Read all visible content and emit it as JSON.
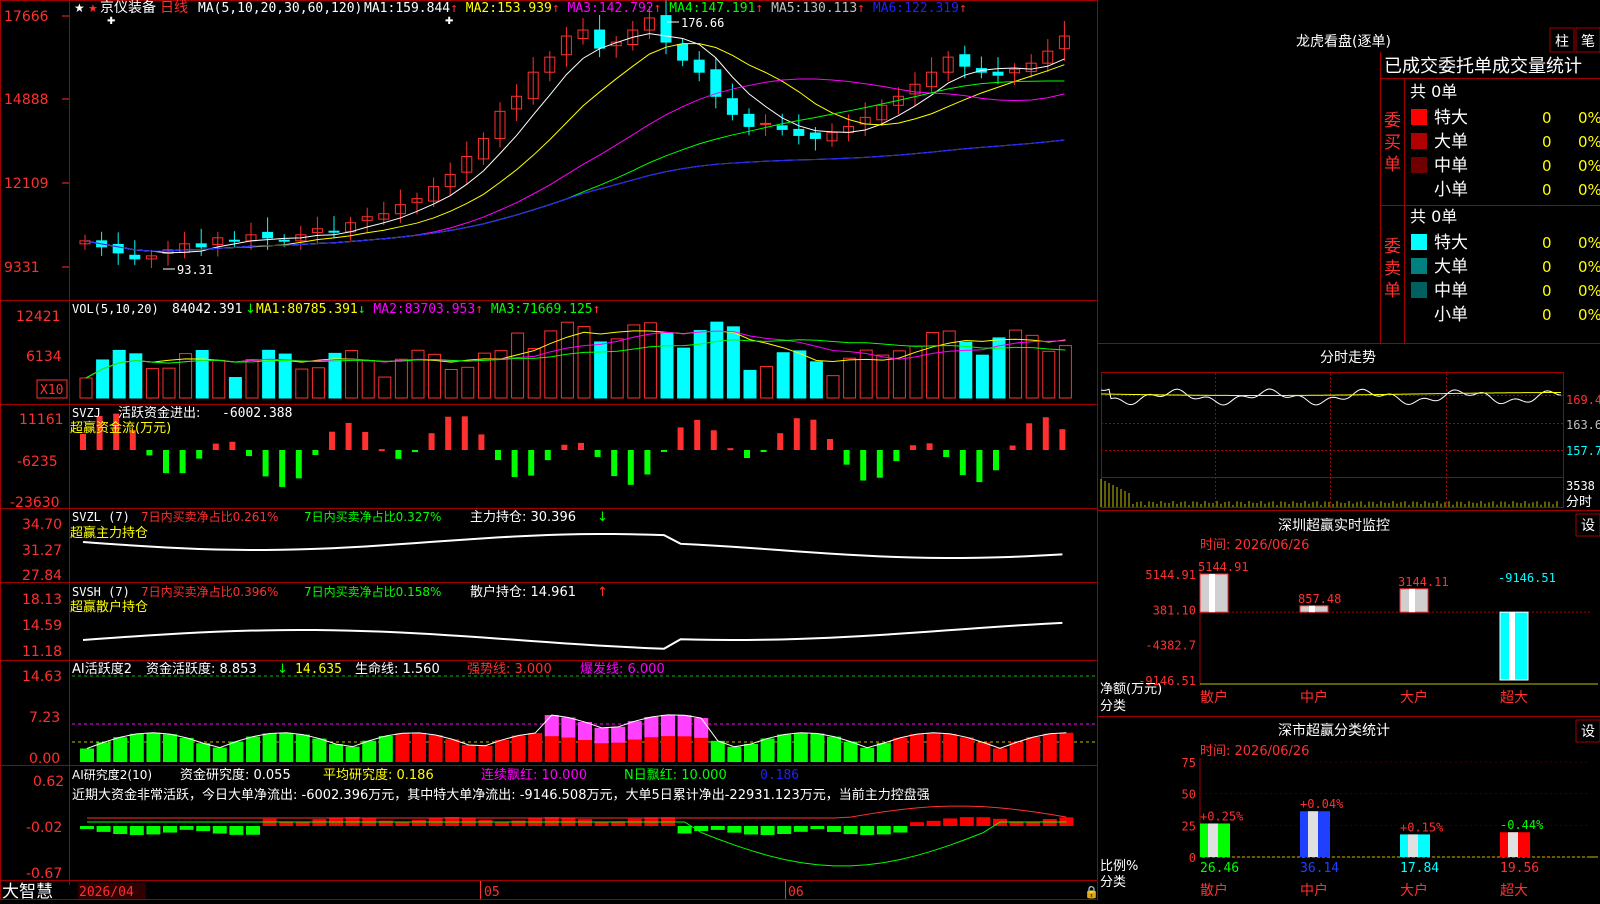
{
  "stock": {
    "name": "京仪装备",
    "period": "日线",
    "footer_brand": "大智慧"
  },
  "main_panel": {
    "ma_title": "MA(5,10,20,30,60,120)",
    "indicators": [
      {
        "label": "MA1:",
        "value": "159.844",
        "arrow": "↑",
        "color": "#ffffff"
      },
      {
        "label": "MA2:",
        "value": "153.939",
        "arrow": "↑",
        "color": "#ffff00"
      },
      {
        "label": "MA3:",
        "value": "142.792",
        "arrow": "↑",
        "color": "#ff00ff"
      },
      {
        "label": "MA4:",
        "value": "147.191",
        "arrow": "↑",
        "color": "#00ff00"
      },
      {
        "label": "MA5:",
        "value": "130.113",
        "arrow": "↑",
        "color": "#c0c0c0"
      },
      {
        "label": "MA6:",
        "value": "122.319",
        "arrow": "↑",
        "color": "#2020ff"
      }
    ],
    "y_ticks": [
      "17666",
      "14888",
      "12109",
      "9331"
    ],
    "high_label": "176.66",
    "low_label": "93.31"
  },
  "vol_panel": {
    "title": "VOL(5,10,20)",
    "value": "84042.391",
    "arrow": "↓",
    "ma": [
      {
        "label": "MA1:",
        "value": "80785.391",
        "arrow": "↓",
        "color": "#ffff00"
      },
      {
        "label": "MA2:",
        "value": "83703.953",
        "arrow": "↑",
        "color": "#ff00ff"
      },
      {
        "label": "MA3:",
        "value": "71669.125",
        "arrow": "↑",
        "color": "#00ff00"
      }
    ],
    "y_ticks": [
      "12421",
      "6134"
    ],
    "unit": "X10"
  },
  "svzj_panel": {
    "title": "SVZJ",
    "label": "活跃资金进出:",
    "value": "-6002.388",
    "sub": "超赢资金流(万元)",
    "y_ticks": [
      "11161",
      "-6235",
      "-23630"
    ]
  },
  "svzl_panel": {
    "title": "SVZL (7)",
    "a": "7日内买卖净占比0.261%",
    "b": "7日内买卖净占比0.327%",
    "c": "主力持仓: 30.396",
    "arrow": "↓",
    "sub": "超赢主力持仓",
    "y_ticks": [
      "34.70",
      "31.27",
      "27.84"
    ]
  },
  "svsh_panel": {
    "title": "SVSH (7)",
    "a": "7日内买卖净占比0.396%",
    "b": "7日内买卖净占比0.158%",
    "c": "散户持仓: 14.961",
    "arrow": "↑",
    "sub": "超赢散户持仓",
    "y_ticks": [
      "18.13",
      "14.59",
      "11.18"
    ]
  },
  "ai_panel": {
    "title": "AI活跃度2",
    "a": "资金活跃度: 8.853",
    "a_arrow": "↓",
    "b": "14.635",
    "c": "生命线: 1.560",
    "d": "强势线: 3.000",
    "e": "爆发线: 6.000",
    "y_ticks": [
      "14.63",
      "7.23",
      "0.00"
    ]
  },
  "ai_research": {
    "title": "AI研究度2(10)",
    "a": "资金研究度: 0.055",
    "b": "平均研究度: 0.186",
    "c": "连续飘红: 10.000",
    "d": "N日飘红: 10.000",
    "e": "0.186",
    "comment": "近期大资金非常活跃，今日大单净流出: -6002.396万元，其中特大单净流出: -9146.508万元，大单5日累计净出-22931.123万元，当前主力控盘强",
    "y_ticks": [
      "0.62",
      "-0.02",
      "-0.67"
    ]
  },
  "date_axis": [
    "2026/04",
    "05",
    "06"
  ],
  "right": {
    "lhb_title": "龙虎看盘(逐单)",
    "btn_bar": "柱",
    "btn_pen": "笔",
    "stat_header": "已成交委托单成交量统计",
    "buy_side": "委买单",
    "sell_side": "委卖单",
    "buy_total": "共 0单",
    "sell_total": "共 0单",
    "buy_rows": [
      {
        "label": "特大",
        "count": "0",
        "pct": "0%",
        "color": "#ff0000"
      },
      {
        "label": "大单",
        "count": "0",
        "pct": "0%",
        "color": "#b00000"
      },
      {
        "label": "中单",
        "count": "0",
        "pct": "0%",
        "color": "#700000"
      },
      {
        "label": "小单",
        "count": "0",
        "pct": "0%",
        "color": "#000000"
      }
    ],
    "sell_rows": [
      {
        "label": "特大",
        "count": "0",
        "pct": "0%",
        "color": "#00ffff"
      },
      {
        "label": "大单",
        "count": "0",
        "pct": "0%",
        "color": "#008080"
      },
      {
        "label": "中单",
        "count": "0",
        "pct": "0%",
        "color": "#006060"
      },
      {
        "label": "小单",
        "count": "0",
        "pct": "0%",
        "color": "#000000"
      }
    ],
    "intraday_title": "分时走势",
    "intraday_ticks": [
      "169.4",
      "163.6",
      "157.7",
      "3538"
    ],
    "intraday_unit": "分时",
    "monitor_title": "深圳超赢实时监控",
    "set_btn": "设",
    "monitor_time": "时间: 2026/06/26",
    "monitor_yticks": [
      "5144.91",
      "381.10",
      "-4382.7",
      "-9146.51"
    ],
    "monitor_ylabel": "净额(万元)",
    "monitor_xlabel": "分类",
    "classify_title": "深市超赢分类统计",
    "classify_time": "时间: 2026/06/26",
    "classify_yticks": [
      "75",
      "50",
      "25",
      "0"
    ],
    "classify_ylabel": "比例%",
    "classify_xlabel": "分类"
  },
  "chart_data": [
    {
      "type": "bar",
      "title": "深圳超赢实时监控",
      "ylabel": "净额(万元)",
      "xlabel": "分类",
      "categories": [
        "散户",
        "中户",
        "大户",
        "超大"
      ],
      "values": [
        5144.91,
        857.48,
        3144.11,
        -9146.51
      ],
      "value_labels": [
        "5144.91",
        "857.48",
        "3144.11",
        "-9146.51"
      ],
      "ylim": [
        -9146.51,
        5144.91
      ]
    },
    {
      "type": "bar",
      "title": "深市超赢分类统计",
      "ylabel": "比例%",
      "xlabel": "分类",
      "categories": [
        "散户",
        "中户",
        "大户",
        "超大"
      ],
      "values": [
        26.46,
        36.14,
        17.84,
        19.56
      ],
      "changes": [
        "+0.25%",
        "+0.04%",
        "+0.15%",
        "-0.44%"
      ],
      "colors": [
        "#00ff00",
        "#2040ff",
        "#00ffff",
        "#ff0000"
      ],
      "ylim": [
        0,
        75
      ]
    }
  ]
}
